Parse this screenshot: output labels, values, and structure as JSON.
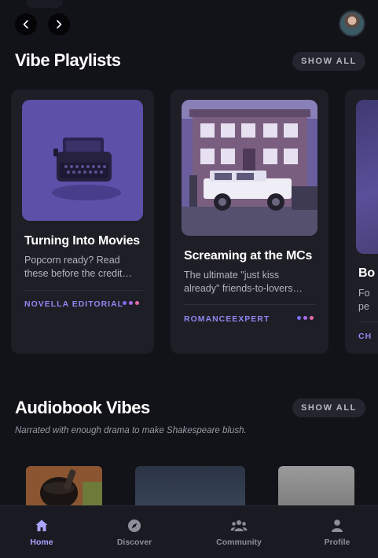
{
  "header": {
    "back_icon": "chevron-left-icon",
    "forward_icon": "chevron-right-icon",
    "avatar": "user-avatar"
  },
  "vibe_playlists": {
    "title": "Vibe Playlists",
    "show_all": "SHOW ALL",
    "cards": [
      {
        "title": "Turning Into Movies",
        "description": "Popcorn ready? Read these before the credit…",
        "author": "NOVELLA EDITORIAL",
        "cover": "typewriter-image"
      },
      {
        "title": "Screaming at the MCs",
        "description": "The ultimate \"just kiss already\" friends-to-lovers…",
        "author": "ROMANCEEXPERT",
        "cover": "house-with-jeep-image"
      },
      {
        "title": "Bo",
        "description_line1": "Fo",
        "description_line2": "pe",
        "author": "CH",
        "cover": "partial-cover-image"
      }
    ]
  },
  "audiobook_vibes": {
    "title": "Audiobook Vibes",
    "show_all": "SHOW ALL",
    "subtitle": "Narrated with enough drama to make Shakespeare blush."
  },
  "bottom_nav": {
    "items": [
      {
        "label": "Home",
        "icon": "home-icon",
        "active": true
      },
      {
        "label": "Discover",
        "icon": "compass-icon",
        "active": false
      },
      {
        "label": "Community",
        "icon": "community-icon",
        "active": false
      },
      {
        "label": "Profile",
        "icon": "profile-icon",
        "active": false
      }
    ]
  },
  "colors": {
    "background": "#121219",
    "card": "#1e1e27",
    "accent": "#a9a4ff",
    "author": "#8f88f0"
  }
}
